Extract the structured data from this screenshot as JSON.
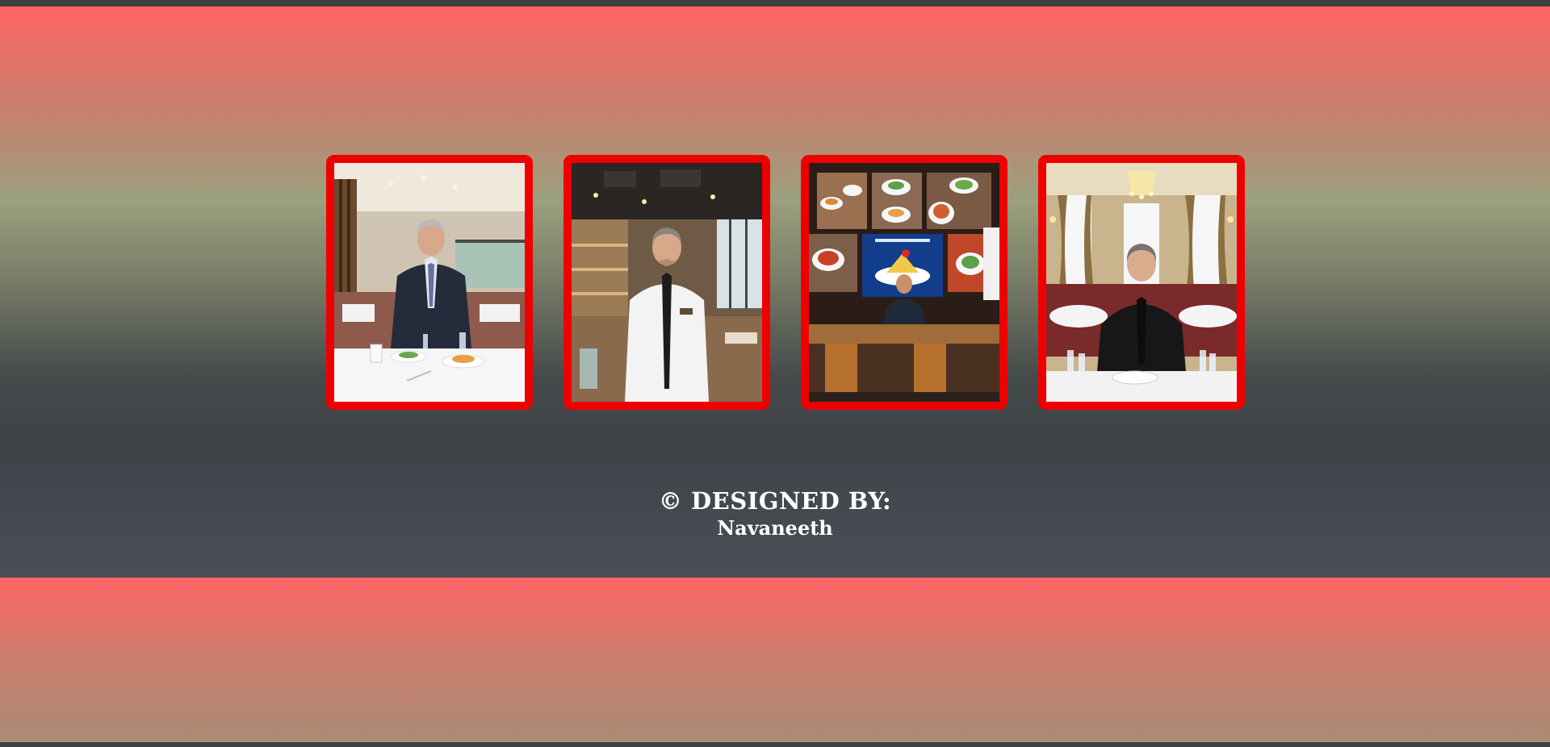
{
  "gallery": {
    "photos": [
      {
        "alt": "Man in dark suit standing in a bright restaurant dining room"
      },
      {
        "alt": "Smiling man in white shirt and black tie in a modern restaurant"
      },
      {
        "alt": "Man seated at a table in front of a wall of food photos"
      },
      {
        "alt": "Man in black suit seated in an elegant banquet hall with a chandelier"
      }
    ]
  },
  "footer": {
    "credit_title": "© DESIGNED BY:",
    "credit_name": "Navaneeth"
  },
  "colors": {
    "accent_red": "#ff6464",
    "frame_red": "#ee0000",
    "dark": "#3a3d42"
  }
}
